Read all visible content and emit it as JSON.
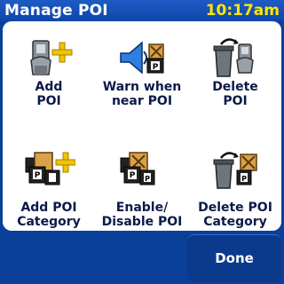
{
  "header": {
    "title": "Manage POI",
    "time": "10:17am"
  },
  "menu": [
    {
      "line1": "Add",
      "line2": "POI"
    },
    {
      "line1": "Warn when",
      "line2": "near POI"
    },
    {
      "line1": "Delete",
      "line2": "POI"
    },
    {
      "line1": "Add POI",
      "line2": "Category"
    },
    {
      "line1": "Enable/",
      "line2": "Disable POI"
    },
    {
      "line1": "Delete POI",
      "line2": "Category"
    }
  ],
  "footer": {
    "done_label": "Done"
  },
  "colors": {
    "background": "#0a3f9a",
    "clock": "#ffe600",
    "panel": "#ffffff",
    "label": "#0b1a4a"
  }
}
